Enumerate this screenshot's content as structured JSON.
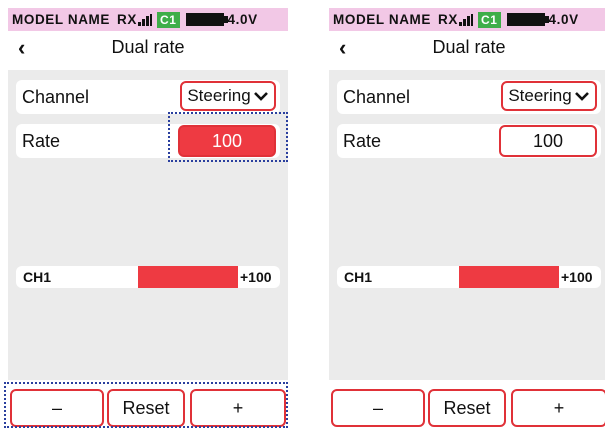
{
  "screens": [
    {
      "status": {
        "model_name": "MODEL NAME",
        "rx": "RX",
        "channel_chip": "C1",
        "voltage": "4.0V"
      },
      "header": {
        "back_glyph": "‹",
        "title": "Dual rate"
      },
      "channel_row": {
        "label": "Channel",
        "value": "Steering"
      },
      "rate_row": {
        "label": "Rate",
        "value": "100",
        "selected": true
      },
      "bar": {
        "label": "CH1",
        "value_text": "+100",
        "value": 100
      },
      "buttons": {
        "minus": "–",
        "reset": "Reset",
        "plus": "+"
      }
    },
    {
      "status": {
        "model_name": "MODEL NAME",
        "rx": "RX",
        "channel_chip": "C1",
        "voltage": "4.0V"
      },
      "header": {
        "back_glyph": "‹",
        "title": "Dual rate"
      },
      "channel_row": {
        "label": "Channel",
        "value": "Steering"
      },
      "rate_row": {
        "label": "Rate",
        "value": "100",
        "selected": false
      },
      "bar": {
        "label": "CH1",
        "value_text": "+100",
        "value": 100
      },
      "buttons": {
        "minus": "–",
        "reset": "Reset",
        "plus": "+"
      }
    }
  ],
  "colors": {
    "accent": "#ee3a42",
    "status_bg": "#f2c8e6",
    "chip": "#3fae49",
    "selection_outline": "#2a3f9e"
  }
}
